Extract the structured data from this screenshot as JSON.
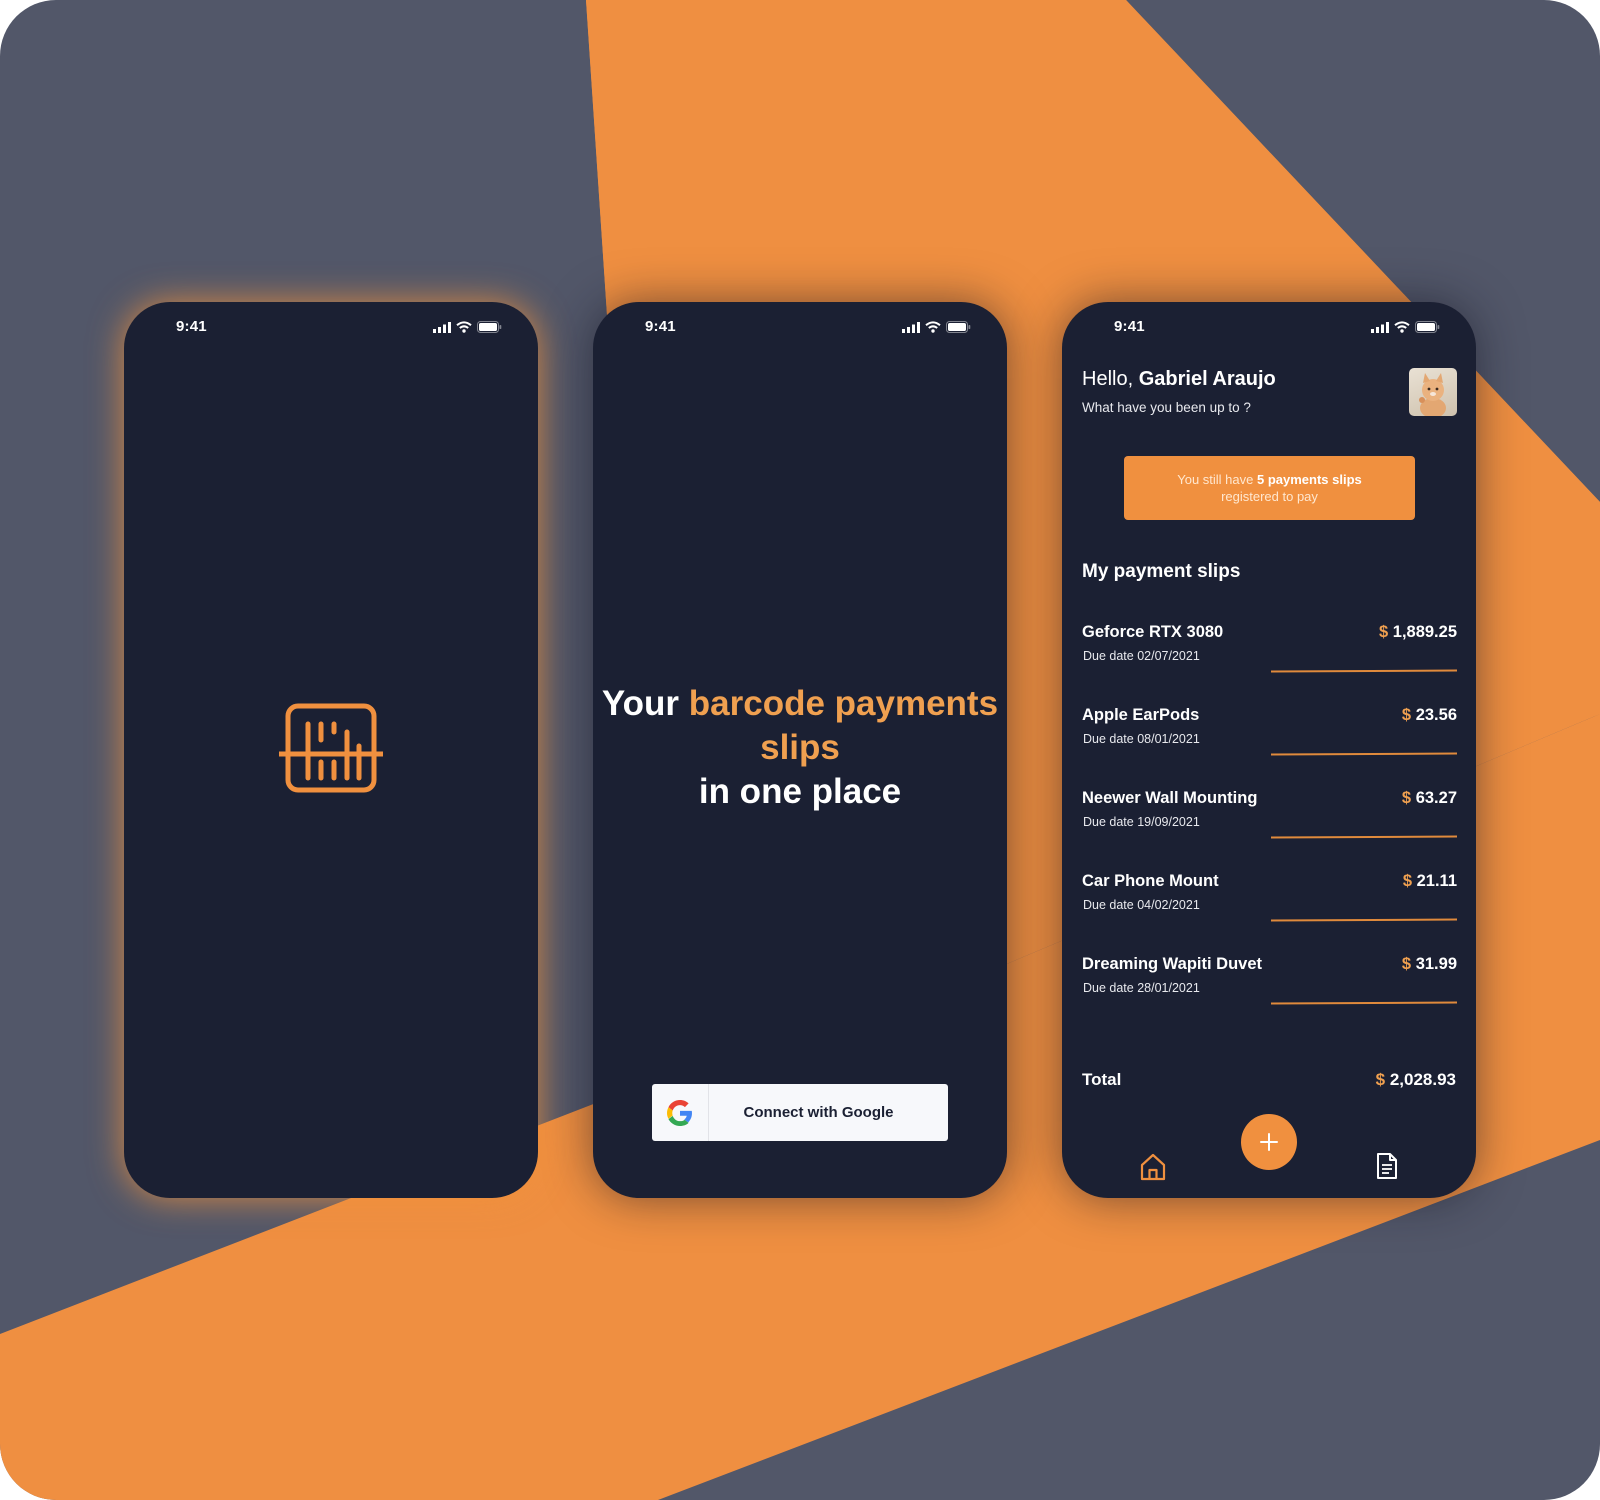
{
  "colors": {
    "background_slate": "#525769",
    "accent_orange": "#f0903f",
    "highlight_text": "#f0a050",
    "phone_background": "#1b2033",
    "white": "#ffffff"
  },
  "screens": [
    {
      "id": "splash",
      "status": {
        "time": "9:41",
        "icons": [
          "signal-icon",
          "wifi-icon",
          "battery-icon"
        ]
      },
      "logo_icon": "barcode-logo-icon"
    },
    {
      "id": "login",
      "status": {
        "time": "9:41"
      },
      "headline": {
        "part1": "Your ",
        "highlight": "barcode payments slips",
        "part2": "in one place"
      },
      "google_button": {
        "icon": "google-icon",
        "label": "Connect with Google"
      }
    },
    {
      "id": "home",
      "status": {
        "time": "9:41"
      },
      "greeting": {
        "hello": "Hello, ",
        "name": "Gabriel Araujo",
        "subtitle": "What have you been up to ?"
      },
      "avatar_icon": "cat-avatar",
      "banner": {
        "prefix": "You still have ",
        "bold": "5 payments slips",
        "suffix": "registered to pay"
      },
      "section_title": "My payment slips",
      "slips": [
        {
          "name": "Geforce RTX 3080",
          "due": "Due date 02/07/2021",
          "currency": "$",
          "amount": "1,889.25"
        },
        {
          "name": "Apple EarPods",
          "due": "Due date 08/01/2021",
          "currency": "$",
          "amount": "23.56"
        },
        {
          "name": "Neewer Wall Mounting",
          "due": "Due date 19/09/2021",
          "currency": "$",
          "amount": "63.27"
        },
        {
          "name": "Car Phone Mount",
          "due": "Due date 04/02/2021",
          "currency": "$",
          "amount": "21.11"
        },
        {
          "name": "Dreaming Wapiti Duvet",
          "due": "Due date 28/01/2021",
          "currency": "$",
          "amount": "31.99"
        }
      ],
      "total": {
        "label": "Total",
        "currency": "$",
        "amount": "2,028.93"
      },
      "nav": {
        "home_icon": "home-icon",
        "add_icon": "plus-icon",
        "slips_icon": "document-icon"
      }
    }
  ]
}
